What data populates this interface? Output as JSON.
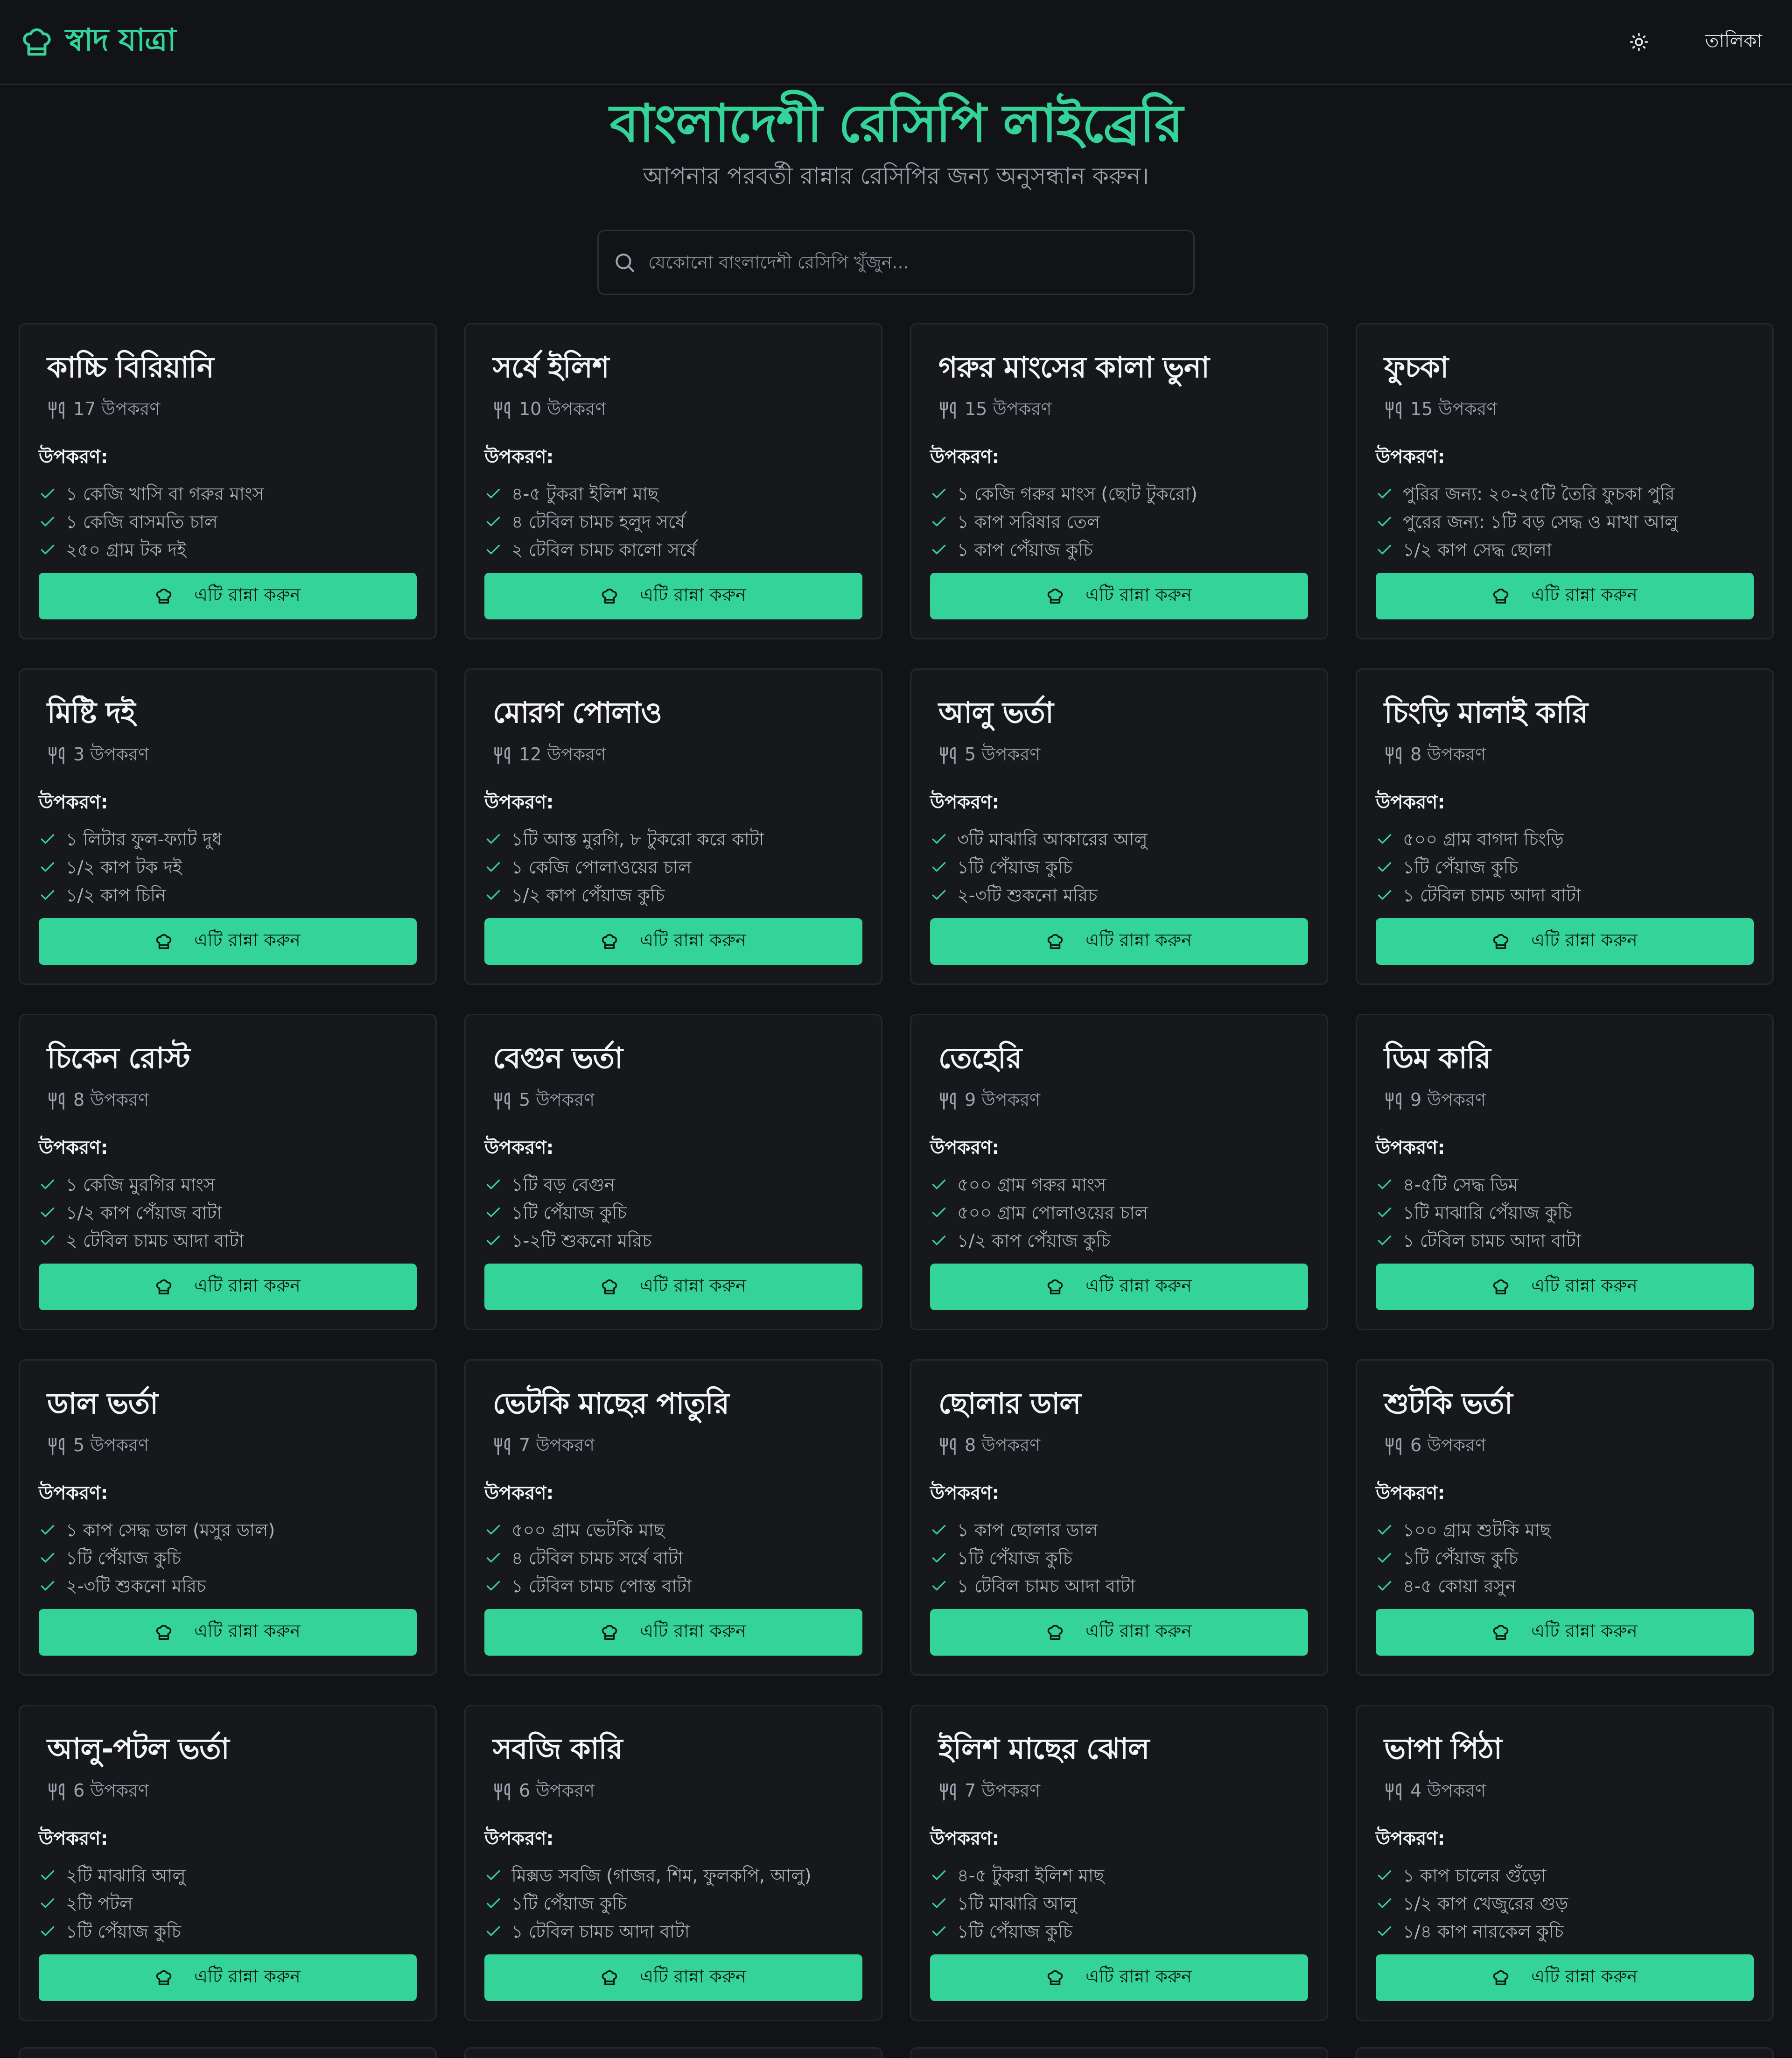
{
  "brand": {
    "name": "স্বাদ যাত্রা",
    "icon": "chef-hat-icon"
  },
  "nav": {
    "theme_icon": "sun-icon",
    "link_label": "তালিকা"
  },
  "hero": {
    "title": "বাংলাদেশী রেসিপি লাইব্রেরি",
    "subtitle": "আপনার পরবর্তী রান্নার রেসিপির জন্য অনুসন্ধান করুন।"
  },
  "search": {
    "placeholder": "যেকোনো বাংলাদেশী রেসিপি খুঁজুন...",
    "value": ""
  },
  "labels": {
    "ingredients_heading": "উপকরণ:",
    "cook_button": "এটি রান্না করুন"
  },
  "colors": {
    "accent": "#34d399",
    "background": "#121316",
    "card": "#17181c"
  },
  "recipes": [
    {
      "title": "কাচ্চি বিরিয়ানি",
      "count": "17 উপকরণ",
      "ingredients": [
        "১ কেজি খাসি বা গরুর মাংস",
        "১ কেজি বাসমতি চাল",
        "২৫০ গ্রাম টক দই"
      ]
    },
    {
      "title": "সর্ষে ইলিশ",
      "count": "10 উপকরণ",
      "ingredients": [
        "৪-৫ টুকরা ইলিশ মাছ",
        "৪ টেবিল চামচ হলুদ সর্ষে",
        "২ টেবিল চামচ কালো সর্ষে"
      ]
    },
    {
      "title": "গরুর মাংসের কালা ভুনা",
      "count": "15 উপকরণ",
      "ingredients": [
        "১ কেজি গরুর মাংস (ছোট টুকরো)",
        "১ কাপ সরিষার তেল",
        "১ কাপ পেঁয়াজ কুচি"
      ]
    },
    {
      "title": "ফুচকা",
      "count": "15 উপকরণ",
      "ingredients": [
        "পুরির জন্য: ২০-২৫টি তৈরি ফুচকা পুরি",
        "পুরের জন্য: ১টি বড় সেদ্ধ ও মাখা আলু",
        "১/২ কাপ সেদ্ধ ছোলা"
      ]
    },
    {
      "title": "মিষ্টি দই",
      "count": "3 উপকরণ",
      "ingredients": [
        "১ লিটার ফুল-ফ্যাট দুধ",
        "১/২ কাপ টক দই",
        "১/২ কাপ চিনি"
      ]
    },
    {
      "title": "মোরগ পোলাও",
      "count": "12 উপকরণ",
      "ingredients": [
        "১টি আস্ত মুরগি, ৮ টুকরো করে কাটা",
        "১ কেজি পোলাওয়ের চাল",
        "১/২ কাপ পেঁয়াজ কুচি"
      ]
    },
    {
      "title": "আলু ভর্তা",
      "count": "5 উপকরণ",
      "ingredients": [
        "৩টি মাঝারি আকারের আলু",
        "১টি পেঁয়াজ কুচি",
        "২-৩টি শুকনো মরিচ"
      ]
    },
    {
      "title": "চিংড়ি মালাই কারি",
      "count": "8 উপকরণ",
      "ingredients": [
        "৫০০ গ্রাম বাগদা চিংড়ি",
        "১টি পেঁয়াজ কুচি",
        "১ টেবিল চামচ আদা বাটা"
      ]
    },
    {
      "title": "চিকেন রোস্ট",
      "count": "8 উপকরণ",
      "ingredients": [
        "১ কেজি মুরগির মাংস",
        "১/২ কাপ পেঁয়াজ বাটা",
        "২ টেবিল চামচ আদা বাটা"
      ]
    },
    {
      "title": "বেগুন ভর্তা",
      "count": "5 উপকরণ",
      "ingredients": [
        "১টি বড় বেগুন",
        "১টি পেঁয়াজ কুচি",
        "১-২টি শুকনো মরিচ"
      ]
    },
    {
      "title": "তেহেরি",
      "count": "9 উপকরণ",
      "ingredients": [
        "৫০০ গ্রাম গরুর মাংস",
        "৫০০ গ্রাম পোলাওয়ের চাল",
        "১/২ কাপ পেঁয়াজ কুচি"
      ]
    },
    {
      "title": "ডিম কারি",
      "count": "9 উপকরণ",
      "ingredients": [
        "৪-৫টি সেদ্ধ ডিম",
        "১টি মাঝারি পেঁয়াজ কুচি",
        "১ টেবিল চামচ আদা বাটা"
      ]
    },
    {
      "title": "ডাল ভর্তা",
      "count": "5 উপকরণ",
      "ingredients": [
        "১ কাপ সেদ্ধ ডাল (মসুর ডাল)",
        "১টি পেঁয়াজ কুচি",
        "২-৩টি শুকনো মরিচ"
      ]
    },
    {
      "title": "ভেটকি মাছের পাতুরি",
      "count": "7 উপকরণ",
      "ingredients": [
        "৫০০ গ্রাম ভেটকি মাছ",
        "৪ টেবিল চামচ সর্ষে বাটা",
        "১ টেবিল চামচ পোস্ত বাটা"
      ]
    },
    {
      "title": "ছোলার ডাল",
      "count": "8 উপকরণ",
      "ingredients": [
        "১ কাপ ছোলার ডাল",
        "১টি পেঁয়াজ কুচি",
        "১ টেবিল চামচ আদা বাটা"
      ]
    },
    {
      "title": "শুটকি ভর্তা",
      "count": "6 উপকরণ",
      "ingredients": [
        "১০০ গ্রাম শুটকি মাছ",
        "১টি পেঁয়াজ কুচি",
        "৪-৫ কোয়া রসুন"
      ]
    },
    {
      "title": "আলু-পটল ভর্তা",
      "count": "6 উপকরণ",
      "ingredients": [
        "২টি মাঝারি আলু",
        "২টি পটল",
        "১টি পেঁয়াজ কুচি"
      ]
    },
    {
      "title": "সবজি কারি",
      "count": "6 উপকরণ",
      "ingredients": [
        "মিক্সড সবজি (গাজর, শিম, ফুলকপি, আলু)",
        "১টি পেঁয়াজ কুচি",
        "১ টেবিল চামচ আদা বাটা"
      ]
    },
    {
      "title": "ইলিশ মাছের ঝোল",
      "count": "7 উপকরণ",
      "ingredients": [
        "৪-৫ টুকরা ইলিশ মাছ",
        "১টি মাঝারি আলু",
        "১টি পেঁয়াজ কুচি"
      ]
    },
    {
      "title": "ভাপা পিঠা",
      "count": "4 উপকরণ",
      "ingredients": [
        "১ কাপ চালের গুঁড়ো",
        "১/২ কাপ খেজুরের গুড়",
        "১/৪ কাপ নারকেল কুচি"
      ]
    }
  ]
}
